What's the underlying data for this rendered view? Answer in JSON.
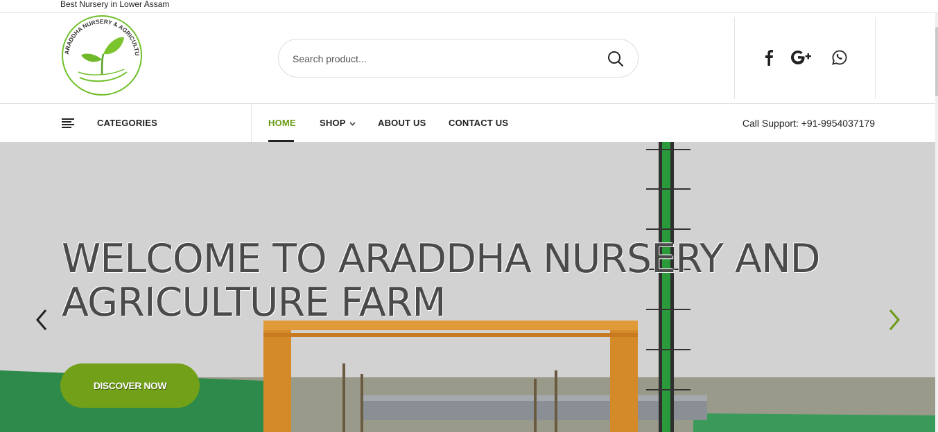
{
  "topbar": {
    "tagline": "Best Nursery in Lower Assam"
  },
  "header": {
    "logo_text": "ARADDHA NURSERY & AGRICULTURE FARM",
    "search": {
      "placeholder": "Search product..."
    },
    "social": [
      "facebook-icon",
      "google-plus-icon",
      "whatsapp-icon"
    ]
  },
  "nav": {
    "categories_label": "CATEGORIES",
    "items": [
      {
        "label": "HOME",
        "active": true
      },
      {
        "label": "SHOP",
        "has_dropdown": true
      },
      {
        "label": "ABOUT US"
      },
      {
        "label": "CONTACT US"
      }
    ],
    "support": "Call Support: +91-9954037179"
  },
  "hero": {
    "title": "WELCOME TO ARADDHA NURSERY AND AGRICULTURE FARM",
    "button_label": "DISCOVER NOW"
  },
  "colors": {
    "accent": "#72a018",
    "active_nav": "#6a9a16",
    "text": "#222222"
  }
}
